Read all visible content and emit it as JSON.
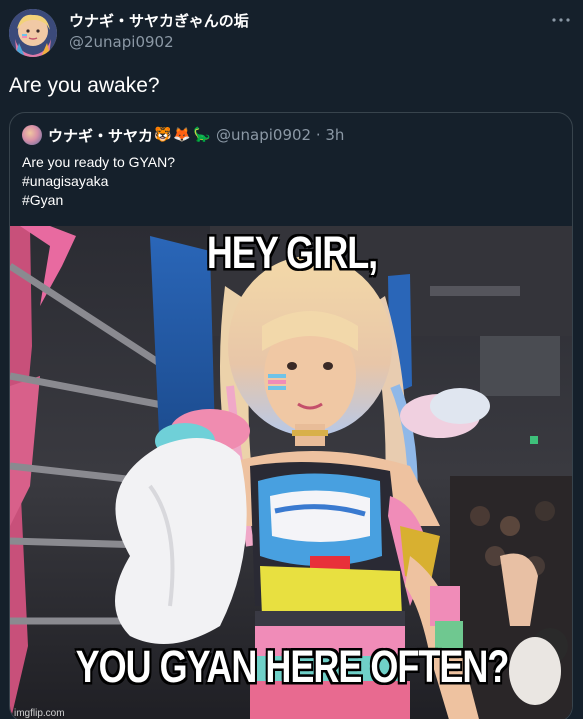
{
  "tweet": {
    "author_name": "ウナギ・サヤカぎゃんの垢",
    "author_handle": "@2unapi0902",
    "text": "Are you awake?",
    "more_icon": "more-horizontal-icon"
  },
  "quoted_tweet": {
    "author_name": "ウナギ・サヤカ",
    "emojis": [
      "🐯",
      "🦊",
      "🦕"
    ],
    "handle_time": "@unapi0902 · 3h",
    "lines": [
      "Are you ready to GYAN?",
      "#unagisayaka",
      "#Gyan"
    ]
  },
  "meme": {
    "top_text": "HEY GIRL,",
    "bottom_text": "YOU GYAN HERE OFTEN?",
    "watermark": "imgflip.com"
  }
}
